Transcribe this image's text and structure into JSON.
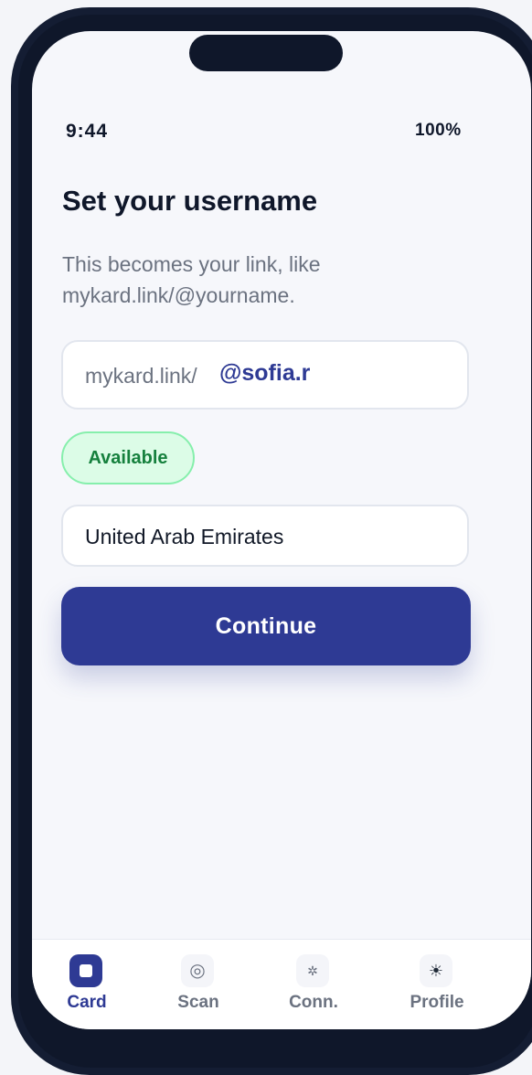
{
  "status_bar": {
    "time": "9:44",
    "battery": "100%"
  },
  "page": {
    "title": "Set your username",
    "subtitle": "This becomes your link, like mykard.link/@yourname."
  },
  "username_field": {
    "prefix": "mykard.link/",
    "value": "@sofia.r"
  },
  "availability_badge": {
    "label": "Available",
    "color": "#15803d"
  },
  "country_field": {
    "value": "United Arab Emirates"
  },
  "continue_button": {
    "label": "Continue",
    "color": "#2e3a94"
  },
  "tabbar": {
    "items": [
      {
        "label": "Card",
        "icon": "card-icon",
        "active": true
      },
      {
        "label": "Scan",
        "icon": "scan-icon",
        "active": false
      },
      {
        "label": "Conn.",
        "icon": "connections-icon",
        "active": false
      },
      {
        "label": "Profile",
        "icon": "profile-icon",
        "active": false
      }
    ]
  },
  "colors": {
    "accent": "#2e3a94",
    "background": "#f6f7fb",
    "frame": "#0f172a"
  }
}
